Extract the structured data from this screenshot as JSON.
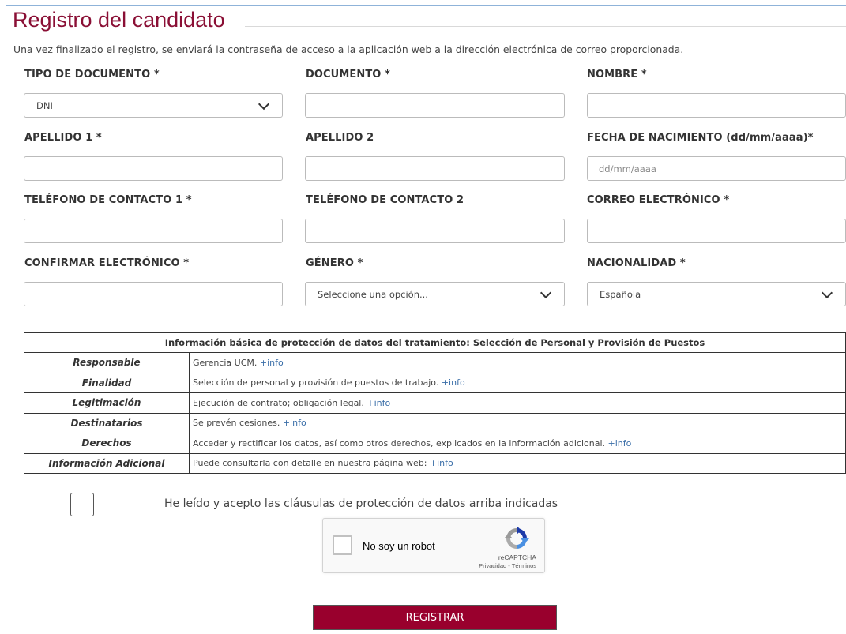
{
  "page": {
    "title": "Registro del candidato",
    "intro": "Una vez finalizado el registro, se enviará la contraseña de acceso a la aplicación web a la dirección electrónica de correo proporcionada."
  },
  "form": {
    "tipo_documento": {
      "label": "TIPO DE DOCUMENTO *",
      "value": "DNI"
    },
    "documento": {
      "label": "DOCUMENTO *",
      "value": ""
    },
    "nombre": {
      "label": "NOMBRE *",
      "value": ""
    },
    "apellido1": {
      "label": "APELLIDO 1 *",
      "value": ""
    },
    "apellido2": {
      "label": "APELLIDO 2",
      "value": ""
    },
    "fecha_nacimiento": {
      "label": "FECHA DE NACIMIENTO (dd/mm/aaaa)*",
      "placeholder": "dd/mm/aaaa",
      "value": ""
    },
    "telefono1": {
      "label": "TELÉFONO DE CONTACTO 1 *",
      "value": ""
    },
    "telefono2": {
      "label": "TELÉFONO DE CONTACTO 2",
      "value": ""
    },
    "correo": {
      "label": "CORREO ELECTRÓNICO *",
      "value": ""
    },
    "confirmar": {
      "label": "CONFIRMAR ELECTRÓNICO *",
      "value": ""
    },
    "genero": {
      "label": "GÉNERO *",
      "value": "Seleccione una opción..."
    },
    "nacionalidad": {
      "label": "NACIONALIDAD *",
      "value": "Española"
    }
  },
  "privacy": {
    "header": "Información básica de protección de datos del tratamiento: Selección de Personal y Provisión de Puestos",
    "more_label": "+info",
    "rows": [
      {
        "label": "Responsable",
        "text": "Gerencia UCM."
      },
      {
        "label": "Finalidad",
        "text": "Selección de personal y provisión de puestos de trabajo."
      },
      {
        "label": "Legitimación",
        "text": "Ejecución de contrato; obligación legal."
      },
      {
        "label": "Destinatarios",
        "text": "Se prevén cesiones."
      },
      {
        "label": "Derechos",
        "text": "Acceder y rectificar los datos, así como otros derechos, explicados en la información adicional."
      },
      {
        "label": "Información Adicional",
        "text": "Puede consultarla con detalle en nuestra página web:"
      }
    ]
  },
  "accept": {
    "text": "He leído y acepto las cláusulas de protección de datos arriba indicadas",
    "checked": false
  },
  "captcha": {
    "label": "No soy un robot",
    "brand": "reCAPTCHA",
    "privacy": "Privacidad",
    "separator": " - ",
    "terms": "Términos"
  },
  "submit_label": "REGISTRAR",
  "colors": {
    "brand": "#8a0f35",
    "button": "#99002d",
    "link": "#3a6ea8"
  }
}
